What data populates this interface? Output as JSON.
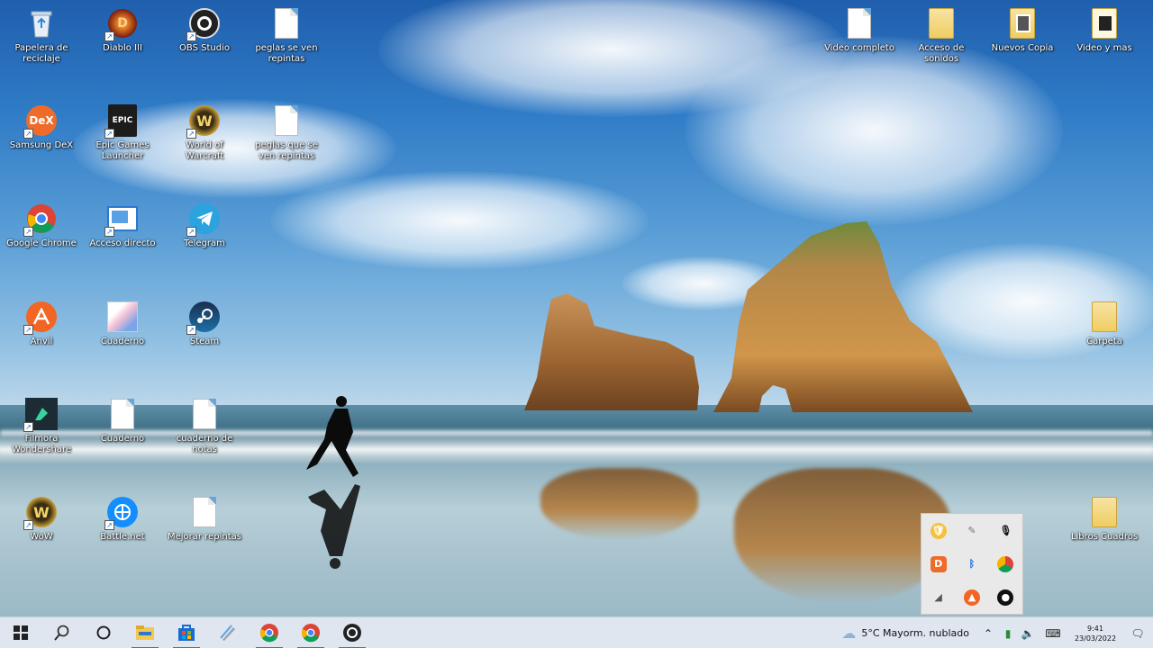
{
  "desktop": {
    "icons": [
      {
        "label": "Papelera de reciclaje",
        "kind": "recycle-bin"
      },
      {
        "label": "Diablo III",
        "kind": "diablo"
      },
      {
        "label": "OBS Studio",
        "kind": "obs"
      },
      {
        "label": "peglas se ven repintas",
        "kind": "doc"
      },
      {
        "label": "Samsung DeX",
        "kind": "dex"
      },
      {
        "label": "Epic Games Launcher",
        "kind": "epic"
      },
      {
        "label": "World of Warcraft",
        "kind": "wow"
      },
      {
        "label": "peglas que se ven repintas",
        "kind": "doc"
      },
      {
        "label": "Google Chrome",
        "kind": "chrome"
      },
      {
        "label": "Acceso directo",
        "kind": "window"
      },
      {
        "label": "Telegram",
        "kind": "telegram"
      },
      {
        "label": "Anvil",
        "kind": "anvil"
      },
      {
        "label": "Cuaderno",
        "kind": "manga"
      },
      {
        "label": "Steam",
        "kind": "steam"
      },
      {
        "label": "Filmora Wondershare",
        "kind": "filmora"
      },
      {
        "label": "Cuaderno",
        "kind": "doc"
      },
      {
        "label": "cuaderno de notas",
        "kind": "doc"
      },
      {
        "label": "WoW",
        "kind": "wow"
      },
      {
        "label": "Battle.net",
        "kind": "battlenet"
      },
      {
        "label": "Mejorar repintas",
        "kind": "doc"
      },
      {
        "label": "Video completo",
        "kind": "doc"
      },
      {
        "label": "Acceso de sonidos",
        "kind": "folder"
      },
      {
        "label": "Nuevos Copia",
        "kind": "folder-photo"
      },
      {
        "label": "Video y mas",
        "kind": "folder-photo"
      },
      {
        "label": "Carpeta",
        "kind": "folder"
      },
      {
        "label": "Libros Cuadros",
        "kind": "folder"
      }
    ]
  },
  "tray_popup": {
    "items": [
      "shield-icon",
      "pen-icon",
      "mic-icon",
      "dex-icon",
      "bluetooth-icon",
      "chrome-icon",
      "network-icon",
      "avast-icon",
      "record-icon"
    ]
  },
  "taskbar": {
    "pinned": [
      "start",
      "search",
      "cortana",
      "file-explorer",
      "store",
      "notepad",
      "chrome",
      "chrome-2",
      "obs"
    ],
    "weather": "5°C  Mayorm. nublado",
    "time": "9:41",
    "date": "23/03/2022"
  },
  "colors": {
    "taskbar_bg": "#dfe6ef",
    "accent": "#2b78d0"
  }
}
